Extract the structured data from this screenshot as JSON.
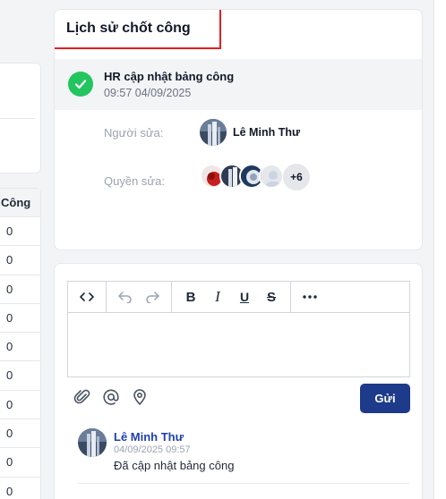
{
  "left_table": {
    "header": "Công",
    "rows": [
      "0",
      "0",
      "0",
      "0",
      "0",
      "0",
      "0",
      "0",
      "0",
      "0"
    ]
  },
  "history": {
    "title": "Lịch sử chốt công",
    "entry": {
      "title": "HR cập nhật bảng công",
      "time": "09:57 04/09/2025",
      "icon": "check-icon",
      "status_color": "#22c55e"
    },
    "editor_label": "Người sửa:",
    "editor_name": "Lê Minh Thư",
    "permission_label": "Quyền sửa:",
    "permission_more": "+6"
  },
  "comment_box": {
    "toolbar": {
      "code": "code-icon",
      "undo": "undo-icon",
      "redo": "redo-icon",
      "bold": "B",
      "italic": "I",
      "underline": "U",
      "strike": "S",
      "more": "more-icon"
    },
    "attach_icons": [
      "paperclip-icon",
      "at-icon",
      "location-icon"
    ],
    "send_label": "Gửi",
    "accent_color": "#1e3a8a"
  },
  "comments": [
    {
      "author": "Lê Minh Thư",
      "time": "04/09/2025 09:57",
      "text": "Đã cập nhật bảng công"
    }
  ]
}
